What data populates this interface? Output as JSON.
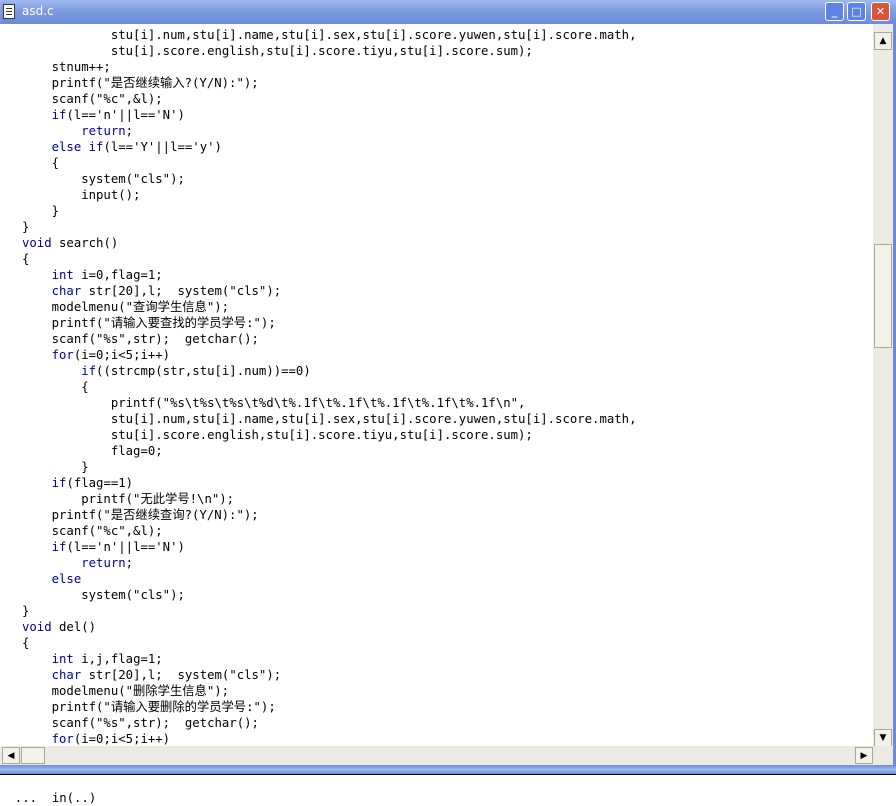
{
  "window": {
    "title": "asd.c"
  },
  "icons": {
    "file": "document-icon",
    "minimize": "minimize-icon",
    "maximize": "maximize-icon",
    "close": "close-icon"
  },
  "code_lines": [
    [
      {
        "t": "            stu[i].num,stu[i].name,stu[i].sex,stu[i].score.yuwen,stu[i].score.math,"
      }
    ],
    [
      {
        "t": "            stu[i].score.english,stu[i].score.tiyu,stu[i].score.sum);"
      }
    ],
    [
      {
        "t": "    stnum++;"
      }
    ],
    [
      {
        "t": "    printf(\"是否继续输入?(Y/N):\");"
      }
    ],
    [
      {
        "t": "    scanf(\"%c\",&l);"
      }
    ],
    [
      {
        "t": "    "
      },
      {
        "t": "if",
        "k": 1
      },
      {
        "t": "(l=='n'||l=='N')"
      }
    ],
    [
      {
        "t": "        "
      },
      {
        "t": "return",
        "k": 1
      },
      {
        "t": ";"
      }
    ],
    [
      {
        "t": "    "
      },
      {
        "t": "else if",
        "k": 1
      },
      {
        "t": "(l=='Y'||l=='y')"
      }
    ],
    [
      {
        "t": "    {"
      }
    ],
    [
      {
        "t": "        system(\"cls\");"
      }
    ],
    [
      {
        "t": "        input();"
      }
    ],
    [
      {
        "t": "    }"
      }
    ],
    [
      {
        "t": "}"
      }
    ],
    [
      {
        "t": "void",
        "k": 1
      },
      {
        "t": " search()"
      }
    ],
    [
      {
        "t": "{"
      }
    ],
    [
      {
        "t": "    "
      },
      {
        "t": "int",
        "k": 1
      },
      {
        "t": " i=0,flag=1;"
      }
    ],
    [
      {
        "t": "    "
      },
      {
        "t": "char",
        "k": 1
      },
      {
        "t": " str[20],l;  system(\"cls\");"
      }
    ],
    [
      {
        "t": "    modelmenu(\"查询学生信息\");"
      }
    ],
    [
      {
        "t": "    printf(\"请输入要查找的学员学号:\");"
      }
    ],
    [
      {
        "t": "    scanf(\"%s\",str);  getchar();"
      }
    ],
    [
      {
        "t": "    "
      },
      {
        "t": "for",
        "k": 1
      },
      {
        "t": "(i=0;i<5;i++)"
      }
    ],
    [
      {
        "t": "        "
      },
      {
        "t": "if",
        "k": 1
      },
      {
        "t": "((strcmp(str,stu[i].num))==0)"
      }
    ],
    [
      {
        "t": "        {"
      }
    ],
    [
      {
        "t": "            printf(\"%s\\t%s\\t%s\\t%d\\t%.1f\\t%.1f\\t%.1f\\t%.1f\\t%.1f\\n\","
      }
    ],
    [
      {
        "t": "            stu[i].num,stu[i].name,stu[i].sex,stu[i].score.yuwen,stu[i].score.math,"
      }
    ],
    [
      {
        "t": "            stu[i].score.english,stu[i].score.tiyu,stu[i].score.sum);"
      }
    ],
    [
      {
        "t": "            flag=0;"
      }
    ],
    [
      {
        "t": "        }"
      }
    ],
    [
      {
        "t": "    "
      },
      {
        "t": "if",
        "k": 1
      },
      {
        "t": "(flag==1)"
      }
    ],
    [
      {
        "t": "        printf(\"无此学号!\\n\");"
      }
    ],
    [
      {
        "t": "    printf(\"是否继续查询?(Y/N):\");"
      }
    ],
    [
      {
        "t": "    scanf(\"%c\",&l);"
      }
    ],
    [
      {
        "t": "    "
      },
      {
        "t": "if",
        "k": 1
      },
      {
        "t": "(l=='n'||l=='N')"
      }
    ],
    [
      {
        "t": "        "
      },
      {
        "t": "return",
        "k": 1
      },
      {
        "t": ";"
      }
    ],
    [
      {
        "t": "    "
      },
      {
        "t": "else",
        "k": 1
      }
    ],
    [
      {
        "t": "        system(\"cls\");"
      }
    ],
    [
      {
        "t": "}"
      }
    ],
    [
      {
        "t": "void",
        "k": 1
      },
      {
        "t": " del()"
      }
    ],
    [
      {
        "t": "{"
      }
    ],
    [
      {
        "t": "    "
      },
      {
        "t": "int",
        "k": 1
      },
      {
        "t": " i,j,flag=1;"
      }
    ],
    [
      {
        "t": "    "
      },
      {
        "t": "char",
        "k": 1
      },
      {
        "t": " str[20],l;  system(\"cls\");"
      }
    ],
    [
      {
        "t": "    modelmenu(\"删除学生信息\");"
      }
    ],
    [
      {
        "t": "    printf(\"请输入要删除的学员学号:\");"
      }
    ],
    [
      {
        "t": "    scanf(\"%s\",str);  getchar();"
      }
    ],
    [
      {
        "t": "    "
      },
      {
        "t": "for",
        "k": 1
      },
      {
        "t": "(i=0;i<5;i++)"
      }
    ]
  ],
  "below_text": "  ...  in(..)"
}
